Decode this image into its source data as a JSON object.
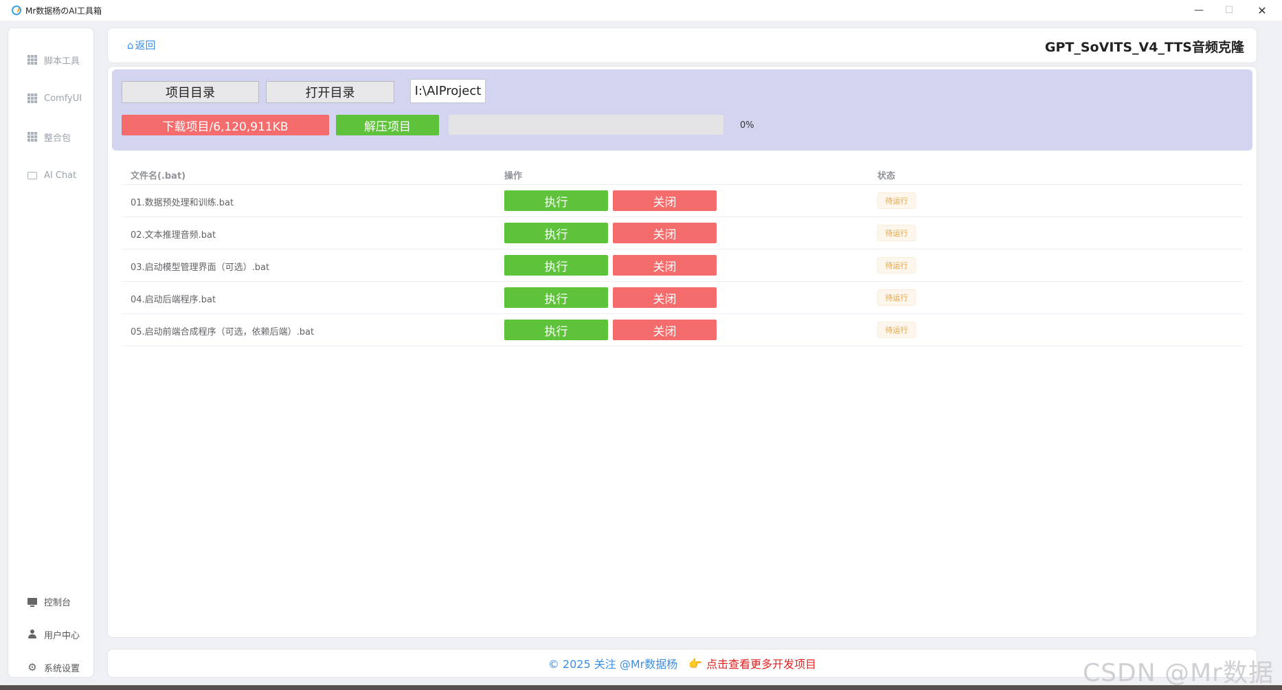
{
  "window": {
    "title": "Mr数据杨のAI工具箱",
    "min_glyph": "—",
    "max_glyph": "☐",
    "close_glyph": "✕"
  },
  "sidebar": {
    "items": [
      {
        "label": "脚本工具",
        "icon": "grid-icon"
      },
      {
        "label": "ComfyUI",
        "icon": "grid-icon"
      },
      {
        "label": "整合包",
        "icon": "grid-icon"
      },
      {
        "label": "AI Chat",
        "icon": "chat-icon"
      }
    ],
    "bottom_items": [
      {
        "label": "控制台",
        "icon": "monitor-icon"
      },
      {
        "label": "用户中心",
        "icon": "user-icon"
      },
      {
        "label": "系统设置",
        "icon": "gear-icon"
      }
    ]
  },
  "header": {
    "back_label": "返回",
    "page_title": "GPT_SoVITS_V4_TTS音频克隆"
  },
  "controls": {
    "project_dir_label": "项目目录",
    "open_dir_label": "打开目录",
    "path_value": "I:\\AIProject",
    "download_label": "下载项目/6,120,911KB",
    "extract_label": "解压项目",
    "progress_percent": 0,
    "progress_text": "0%"
  },
  "table": {
    "headers": {
      "filename": "文件名(.bat)",
      "actions": "操作",
      "status": "状态"
    },
    "rows": [
      {
        "filename": "01.数据预处理和训练.bat",
        "run_label": "执行",
        "close_label": "关闭",
        "status": "待运行"
      },
      {
        "filename": "02.文本推理音频.bat",
        "run_label": "执行",
        "close_label": "关闭",
        "status": "待运行"
      },
      {
        "filename": "03.启动模型管理界面（可选）.bat",
        "run_label": "执行",
        "close_label": "关闭",
        "status": "待运行"
      },
      {
        "filename": "04.启动后端程序.bat",
        "run_label": "执行",
        "close_label": "关闭",
        "status": "待运行"
      },
      {
        "filename": "05.启动前端合成程序（可选，依赖后端）.bat",
        "run_label": "执行",
        "close_label": "关闭",
        "status": "待运行"
      }
    ]
  },
  "footer": {
    "copyright": "© 2025 关注 @Mr数据杨",
    "hand_glyph": "👉",
    "more_link": "点击查看更多开发项目"
  },
  "watermark": "CSDN @Mr数据杨",
  "colors": {
    "accent": "#3a8ee6",
    "danger": "#f56c6c",
    "success": "#5fc23b",
    "panel": "#d3d5f0",
    "warning": "#e6a23c"
  }
}
